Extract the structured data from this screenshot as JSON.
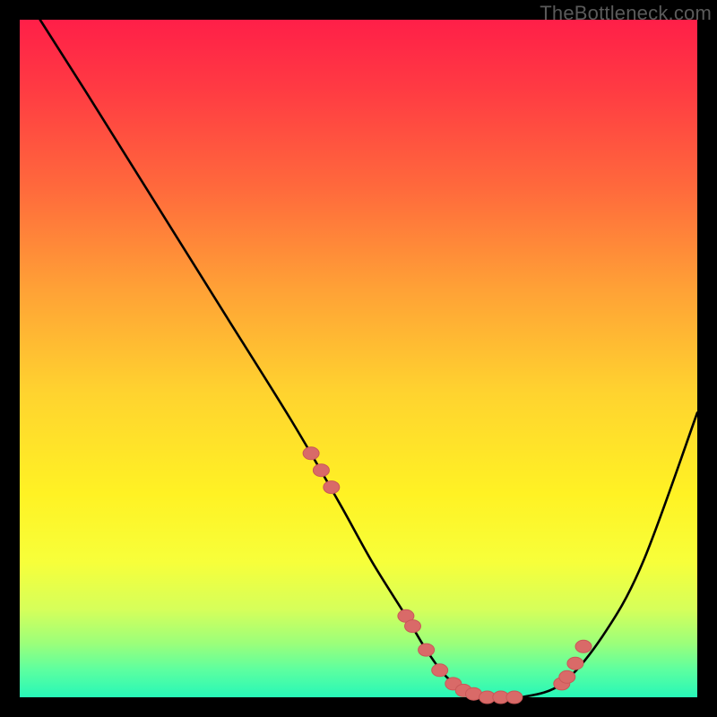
{
  "watermark": "TheBottleneck.com",
  "colors": {
    "background": "#000000",
    "curve": "#000000",
    "marker_fill": "#d96a68",
    "marker_stroke": "#c95858"
  },
  "chart_data": {
    "type": "line",
    "title": "",
    "xlabel": "",
    "ylabel": "",
    "xlim": [
      0,
      100
    ],
    "ylim": [
      0,
      100
    ],
    "series": [
      {
        "name": "curve",
        "x": [
          3,
          10,
          20,
          30,
          40,
          47,
          52,
          57,
          60,
          63,
          66,
          70,
          74,
          80,
          86,
          92,
          100
        ],
        "y": [
          100,
          89,
          73,
          57,
          41,
          29,
          20,
          12,
          7,
          3,
          1,
          0,
          0,
          2,
          9,
          20,
          42
        ]
      }
    ],
    "markers": {
      "name": "highlighted-points",
      "x": [
        43,
        44.5,
        46,
        57,
        58,
        60,
        62,
        64,
        65.5,
        67,
        69,
        71,
        73,
        80,
        80.8,
        82,
        83.2
      ],
      "y": [
        36,
        33.5,
        31,
        12,
        10.5,
        7,
        4,
        2,
        1,
        0.5,
        0,
        0,
        0,
        2,
        3,
        5,
        7.5
      ]
    }
  }
}
